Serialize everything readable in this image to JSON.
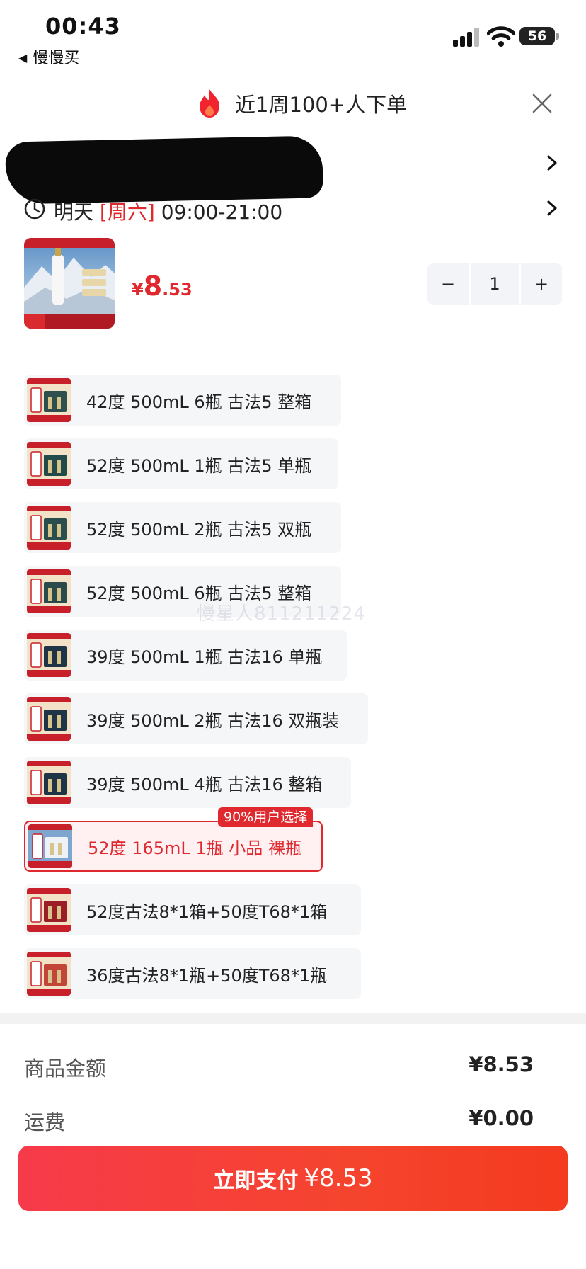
{
  "status_bar": {
    "time": "00:43",
    "back_app": "慢慢买",
    "battery": "56"
  },
  "header": {
    "title": "近1周100+人下单"
  },
  "delivery": {
    "day": "明天",
    "weekday": "[周六]",
    "window": "09:00-21:00"
  },
  "product": {
    "currency": "¥",
    "price_int": "8",
    "price_dec": ".53",
    "quantity": "1",
    "minus": "−",
    "plus": "+"
  },
  "sku_options": [
    {
      "label": "42度 500mL 6瓶 古法5 整箱",
      "selected": false
    },
    {
      "label": "52度 500mL 1瓶 古法5 单瓶",
      "selected": false
    },
    {
      "label": "52度 500mL 2瓶 古法5 双瓶",
      "selected": false
    },
    {
      "label": "52度 500mL 6瓶 古法5 整箱",
      "selected": false
    },
    {
      "label": "39度 500mL 1瓶 古法16 单瓶",
      "selected": false
    },
    {
      "label": "39度 500mL 2瓶 古法16 双瓶装",
      "selected": false
    },
    {
      "label": "39度 500mL 4瓶 古法16 整箱",
      "selected": false
    },
    {
      "label": "52度 165mL 1瓶 小品 裸瓶",
      "selected": true
    },
    {
      "label": "52度古法8*1箱+50度T68*1箱",
      "selected": false
    },
    {
      "label": "36度古法8*1瓶+50度T68*1瓶",
      "selected": false
    }
  ],
  "badge": "90%用户选择",
  "watermark": "慢星人811211224",
  "summary": {
    "goods_label": "商品金额",
    "goods_value": "¥8.53",
    "shipping_label": "运费",
    "shipping_value": "¥0.00"
  },
  "pay_button": {
    "label": "立即支付",
    "amount": "¥8.53"
  },
  "colors": {
    "accent": "#e0292e",
    "pay_start": "#f73a4a",
    "pay_end": "#f43a1f"
  }
}
